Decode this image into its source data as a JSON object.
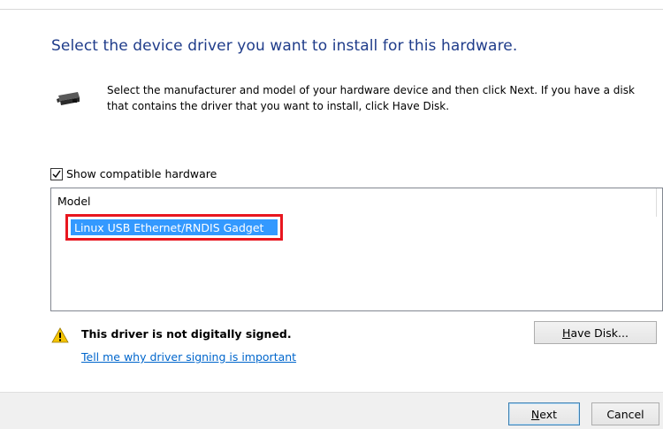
{
  "dialog": {
    "heading": "Select the device driver you want to install for this hardware.",
    "instruction": "Select the manufacturer and model of your hardware device and then click Next. If you have a disk that contains the driver that you want to install, click Have Disk.",
    "hardware_icon": "hardware-card-icon"
  },
  "compat": {
    "label": "Show compatible hardware",
    "checked": true
  },
  "model_list": {
    "header": "Model",
    "items": [
      "Linux USB Ethernet/RNDIS Gadget"
    ],
    "selected_index": 0,
    "highlight_color": "#e8161f",
    "selection_color": "#3399ff"
  },
  "signing": {
    "warning_icon": "warning-icon",
    "warning_text": "This driver is not digitally signed.",
    "link_text": "Tell me why driver signing is important"
  },
  "buttons": {
    "have_disk_accel": "H",
    "have_disk_rest": "ave Disk...",
    "next_accel": "N",
    "next_rest": "ext",
    "cancel_label": "Cancel"
  },
  "colors": {
    "heading": "#1f3c8a",
    "link": "#0066cc"
  }
}
